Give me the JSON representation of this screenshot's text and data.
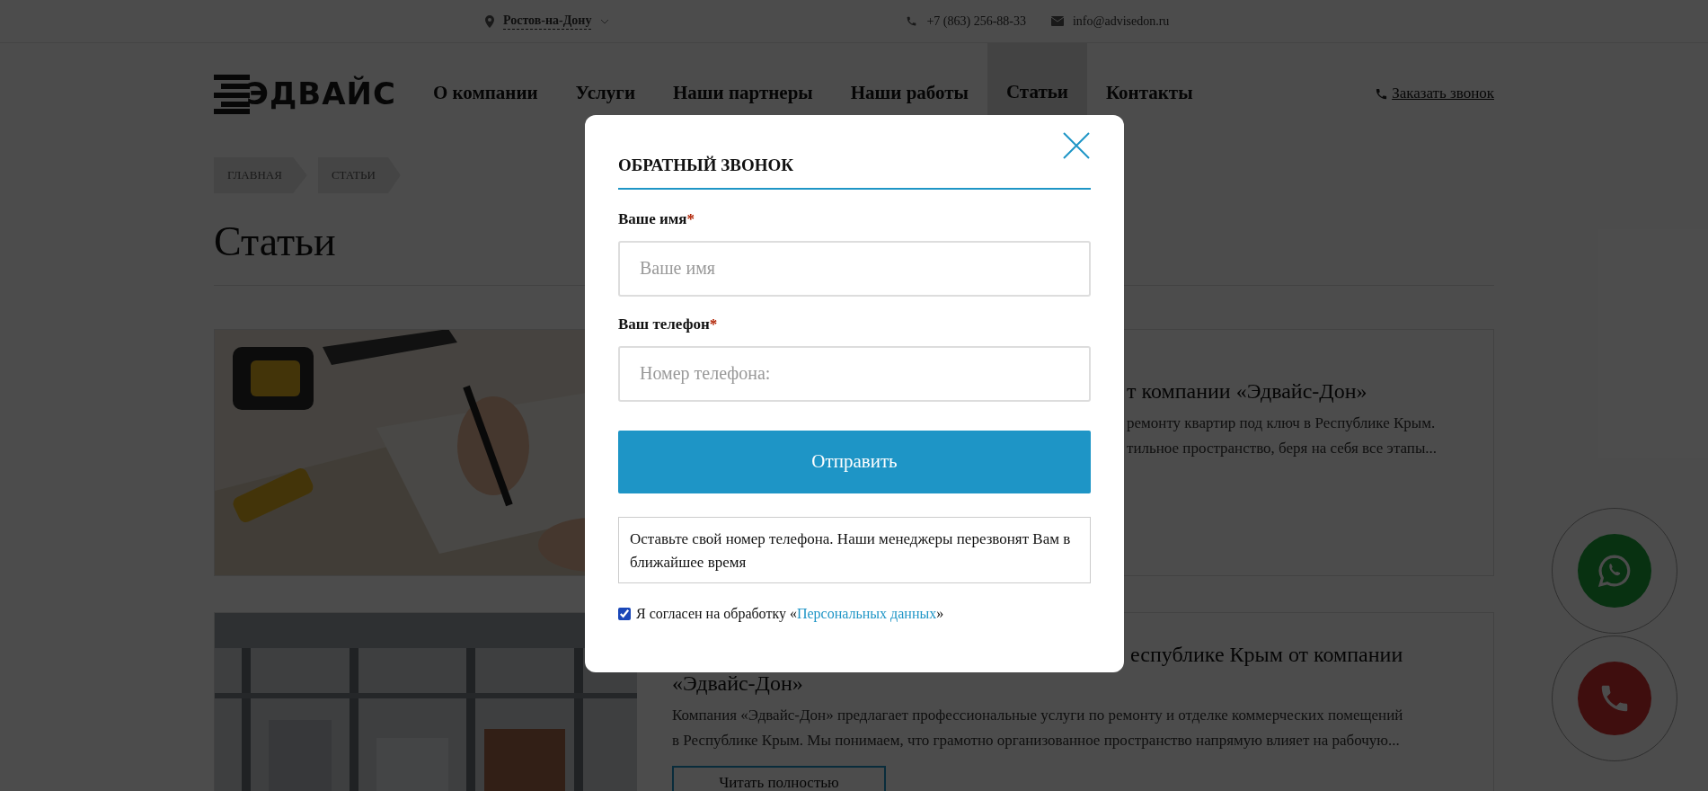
{
  "top_bar": {
    "city": "Ростов-на-Дону",
    "phone": "+7 (863) 256-88-33",
    "email": "info@advisedon.ru"
  },
  "header": {
    "logo": "ЭДВАЙС",
    "nav": [
      {
        "label": "О компании",
        "selected": false
      },
      {
        "label": "Услуги",
        "selected": false
      },
      {
        "label": "Наши партнеры",
        "selected": false
      },
      {
        "label": "Наши работы",
        "selected": false
      },
      {
        "label": "Статьи",
        "selected": true
      },
      {
        "label": "Контакты",
        "selected": false
      }
    ],
    "callback_link": "Заказать звонок"
  },
  "breadcrumbs": [
    "ГЛАВНАЯ",
    "СТАТЬИ"
  ],
  "page_title": "Статьи",
  "articles": [
    {
      "title_lines": [
        "т компании «Эдвайс-Дон»"
      ],
      "excerpt_lines": [
        "ремонту квартир под ключ в Республике Крым.",
        "тильное пространство, беря на себя все этапы..."
      ]
    },
    {
      "title_lines": [
        "еспублике Крым от компании",
        "«Эдвайс-Дон»"
      ],
      "excerpt_lines": [
        "Компания «Эдвайс-Дон» предлагает профессиональные услуги по ремонту и отделке коммерческих помещений",
        "в Республике Крым. Мы понимаем, что грамотно организованное пространство напрямую влияет на рабочую..."
      ],
      "button": "Читать полностью"
    }
  ],
  "modal": {
    "title": "ОБРАТНЫЙ ЗВОНОК",
    "fields": [
      {
        "label": "Ваше имя",
        "mark": "*",
        "placeholder": "Ваше имя"
      },
      {
        "label": "Ваш телефон",
        "mark": "*",
        "placeholder": "Номер телефона:"
      }
    ],
    "submit": "Отправить",
    "note": "Оставьте свой номер телефона. Наши менеджеры перезвонят Вам в ближайшее время",
    "consent": {
      "checked": true,
      "text": "Я согласен на обработку «",
      "link": "Персональных данных",
      "suffix": "»"
    }
  },
  "float_buttons": [
    {
      "kind": "whatsapp"
    },
    {
      "kind": "phone"
    }
  ]
}
